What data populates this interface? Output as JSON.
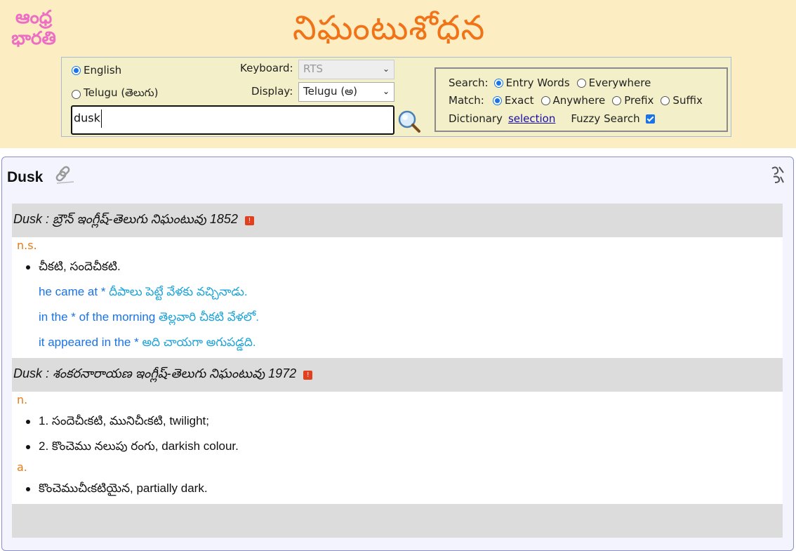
{
  "header": {
    "logo_line1": "ఆంధ్ర",
    "logo_line2": "భారతి",
    "site_title": "నిఘంటుశోధన"
  },
  "search": {
    "lang_english": "English",
    "lang_telugu": "Telugu (తెలుగు)",
    "keyboard_label": "Keyboard:",
    "keyboard_value": "RTS",
    "display_label": "Display:",
    "display_value": "Telugu (అ)",
    "query": "dusk"
  },
  "options": {
    "search_label": "Search:",
    "entry_words": "Entry Words",
    "everywhere": "Everywhere",
    "match_label": "Match:",
    "exact": "Exact",
    "anywhere": "Anywhere",
    "prefix": "Prefix",
    "suffix": "Suffix",
    "dictionary_label": "Dictionary",
    "selection_link": "selection",
    "fuzzy_label": "Fuzzy Search",
    "fuzzy_checked": true
  },
  "result": {
    "word": "Dusk",
    "entries": [
      {
        "source": "Dusk : బ్రౌన్ ఇంగ్లీష్-తెలుగు నిఘంటువు 1852",
        "pos": "n.s.",
        "senses": [
          "చీకటి, సందెచీకటి."
        ],
        "examples": [
          {
            "en": "he came at * ",
            "te": "దీపాలు పెట్టే వేళకు వచ్చినాడు."
          },
          {
            "en": "in the * of the morning ",
            "te": "తెల్లవారి చీకటి వేళలో."
          },
          {
            "en": "it appeared in the * ",
            "te": "అది చాయగా అగుపడ్డది."
          }
        ]
      },
      {
        "source": "Dusk : శంకరనారాయణ ఇంగ్లీష్-తెలుగు నిఘంటువు 1972",
        "pos": "n.",
        "senses": [
          "1. సందెచీఁకటి, మునిచీఁకటి, twilight;",
          "2. కొంచెము నలుపు రంగు, darkish colour."
        ],
        "pos2": "a.",
        "senses2": [
          "కొంచెముచీఁకటియైన, partially dark."
        ]
      }
    ]
  },
  "colors": {
    "header_bg": "#fdedc3",
    "title": "#f07317",
    "logo": "#ec6fc4",
    "pos": "#e87a16",
    "example": "#1da3d8"
  }
}
